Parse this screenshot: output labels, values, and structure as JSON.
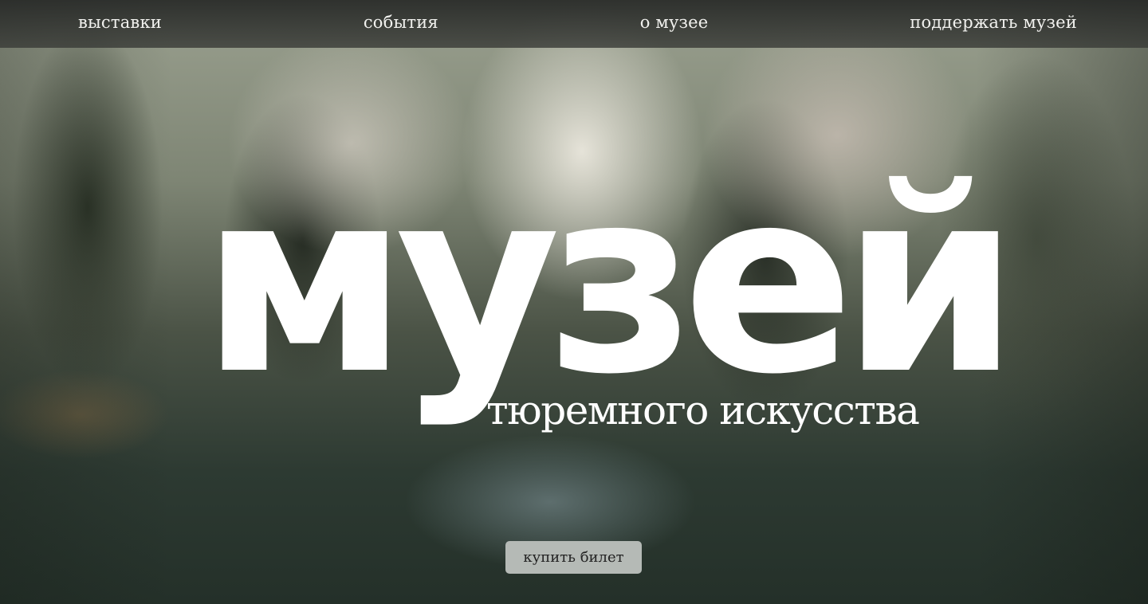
{
  "nav": {
    "items": [
      {
        "label": "выставки"
      },
      {
        "label": "события"
      },
      {
        "label": "о музее"
      },
      {
        "label": "поддержать музей"
      }
    ]
  },
  "hero": {
    "title": "музей",
    "subtitle": "тюремного искусства",
    "cta_label": "купить билет"
  },
  "colors": {
    "nav_background": "#3a3b38",
    "text": "#ffffff",
    "button_background": "#b5bab6",
    "button_text": "#222222"
  }
}
